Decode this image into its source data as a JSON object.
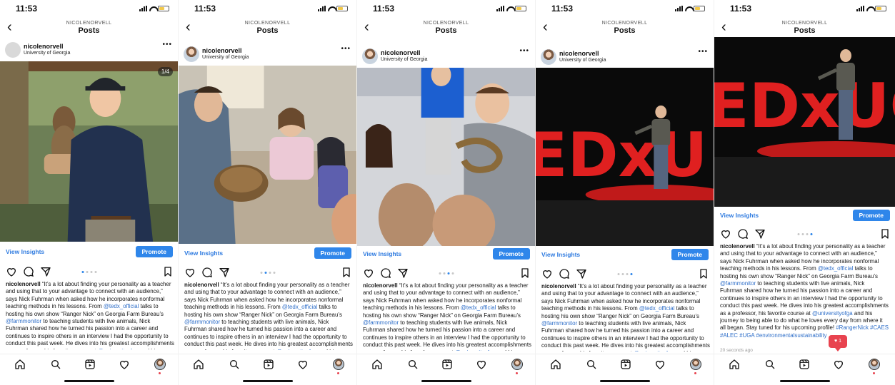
{
  "status_bar": {
    "time": "11:53"
  },
  "header": {
    "username": "NICOLENORVELL",
    "title": "Posts"
  },
  "post": {
    "username": "nicolenorvell",
    "location": "University of Georgia",
    "view_insights": "View Insights",
    "promote": "Promote",
    "photo_counter": "1/4",
    "time_ago": "20 seconds ago",
    "notification_count": "1"
  },
  "caption": [
    {
      "text": "nicolenorvell",
      "style": "bold"
    },
    {
      "text": " “It’s a lot about finding your personality as a teacher and using that to your advantage to connect with an audience,” says Nick Fuhrman when asked how he incorporates nonformal teaching methods in his lessons. From ",
      "style": "text"
    },
    {
      "text": "@tedx_official",
      "style": "mention"
    },
    {
      "text": " talks to hosting his own show “Ranger Nick” on Georgia Farm Bureau’s ",
      "style": "text"
    },
    {
      "text": "@farmmonitor",
      "style": "mention"
    },
    {
      "text": " to teaching students with live animals, Nick Fuhrman shared how he turned his passion into a career and continues to inspire others in an interview I had the opportunity to conduct this past week. He dives into his greatest accomplishments as a professor, his favorite course at ",
      "style": "text"
    },
    {
      "text": "@universityofga",
      "style": "mention"
    },
    {
      "text": " and his journey to being able to do what he loves every day from where it all began. Stay tuned for his upcoming profile! ",
      "style": "text"
    },
    {
      "text": "#RangerNick #CAES #ALEC #UGA #environmentalsustainability",
      "style": "mention"
    }
  ],
  "screens": [
    {
      "carousel_index": 0,
      "avatar": "placeholder",
      "photo": "owl-portrait",
      "show_counter": true,
      "show_timeago": false,
      "show_notification": false
    },
    {
      "carousel_index": 1,
      "avatar": "photo",
      "photo": "tortoise-kids",
      "show_counter": false,
      "show_timeago": false,
      "show_notification": false
    },
    {
      "carousel_index": 2,
      "avatar": "photo",
      "photo": "snake-kids",
      "show_counter": false,
      "show_timeago": false,
      "show_notification": false
    },
    {
      "carousel_index": 3,
      "avatar": "photo",
      "photo": "tedx-stage",
      "show_counter": false,
      "show_timeago": false,
      "show_notification": false
    },
    {
      "carousel_index": 3,
      "avatar": "photo",
      "photo": "tedx-stage-scrolled",
      "show_counter": false,
      "show_timeago": true,
      "show_notification": true
    }
  ],
  "carousel": {
    "count": 4
  },
  "tabs": [
    "home-icon",
    "search-icon",
    "reels-icon",
    "heart-icon",
    "profile-avatar"
  ],
  "icons": [
    "back-icon",
    "more-icon",
    "heart-icon",
    "comment-icon",
    "share-icon",
    "bookmark-icon"
  ],
  "colors": {
    "accent": "#2f86ea",
    "link": "#2f6fc9",
    "tedx_red": "#e02020",
    "notification": "#e8434f"
  }
}
